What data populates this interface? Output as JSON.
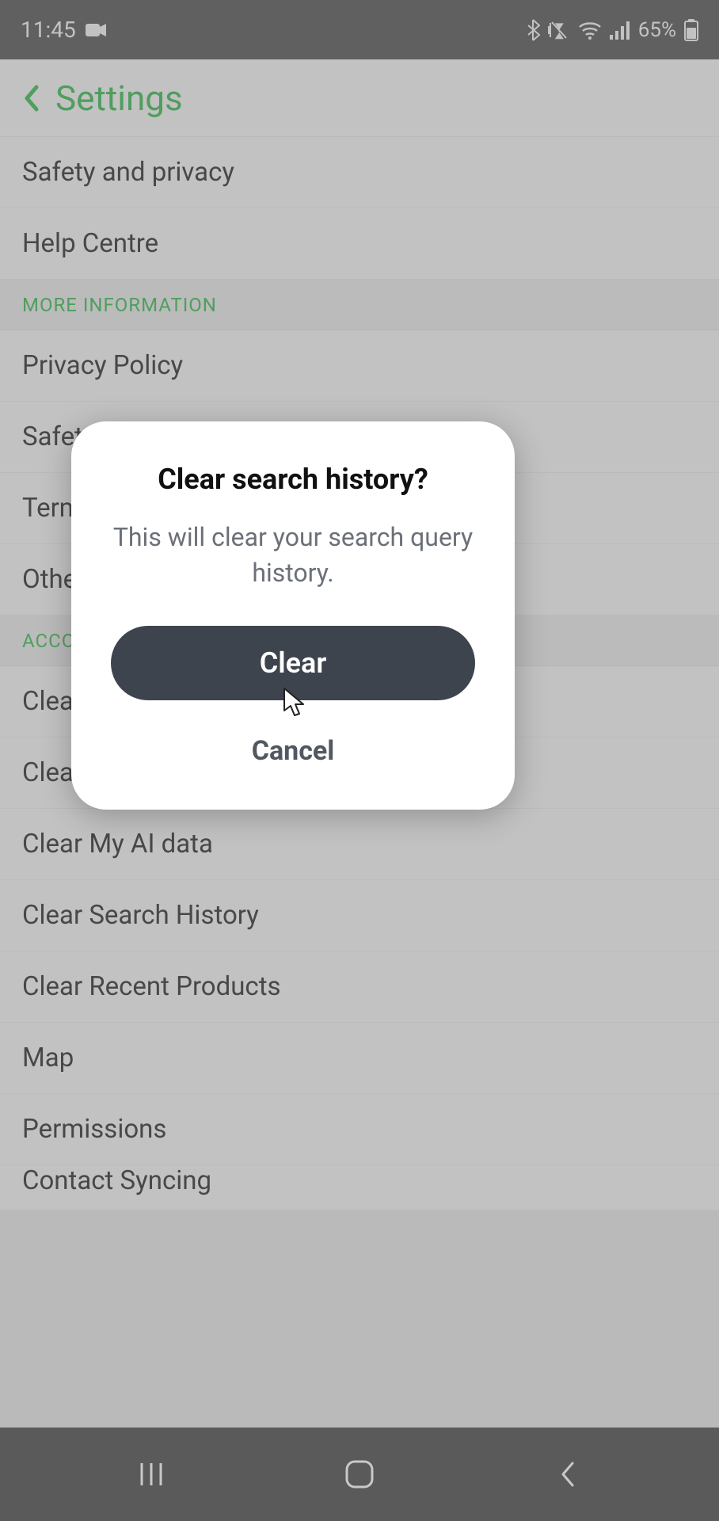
{
  "statusbar": {
    "time": "11:45",
    "battery_text": "65%"
  },
  "header": {
    "title": "Settings"
  },
  "sections": {
    "top_items": [
      {
        "label": "Safety and privacy"
      },
      {
        "label": "Help Centre"
      }
    ],
    "more_info_header": "MORE INFORMATION",
    "more_info_items": [
      {
        "label": "Privacy Policy"
      },
      {
        "label": "Safety Centre"
      },
      {
        "label": "Terms of Service"
      },
      {
        "label": "Other Legal"
      }
    ],
    "account_actions_header": "ACCOUNT ACTIONS",
    "account_action_items": [
      {
        "label": "Clear Cache"
      },
      {
        "label": "Clear Conversations"
      },
      {
        "label": "Clear My AI data"
      },
      {
        "label": "Clear Search History"
      },
      {
        "label": "Clear Recent Products"
      },
      {
        "label": "Map"
      },
      {
        "label": "Permissions"
      }
    ],
    "partial_item_label": "Contact Syncing"
  },
  "dialog": {
    "title": "Clear search history?",
    "message": "This will clear your search query history.",
    "clear_label": "Clear",
    "cancel_label": "Cancel"
  }
}
